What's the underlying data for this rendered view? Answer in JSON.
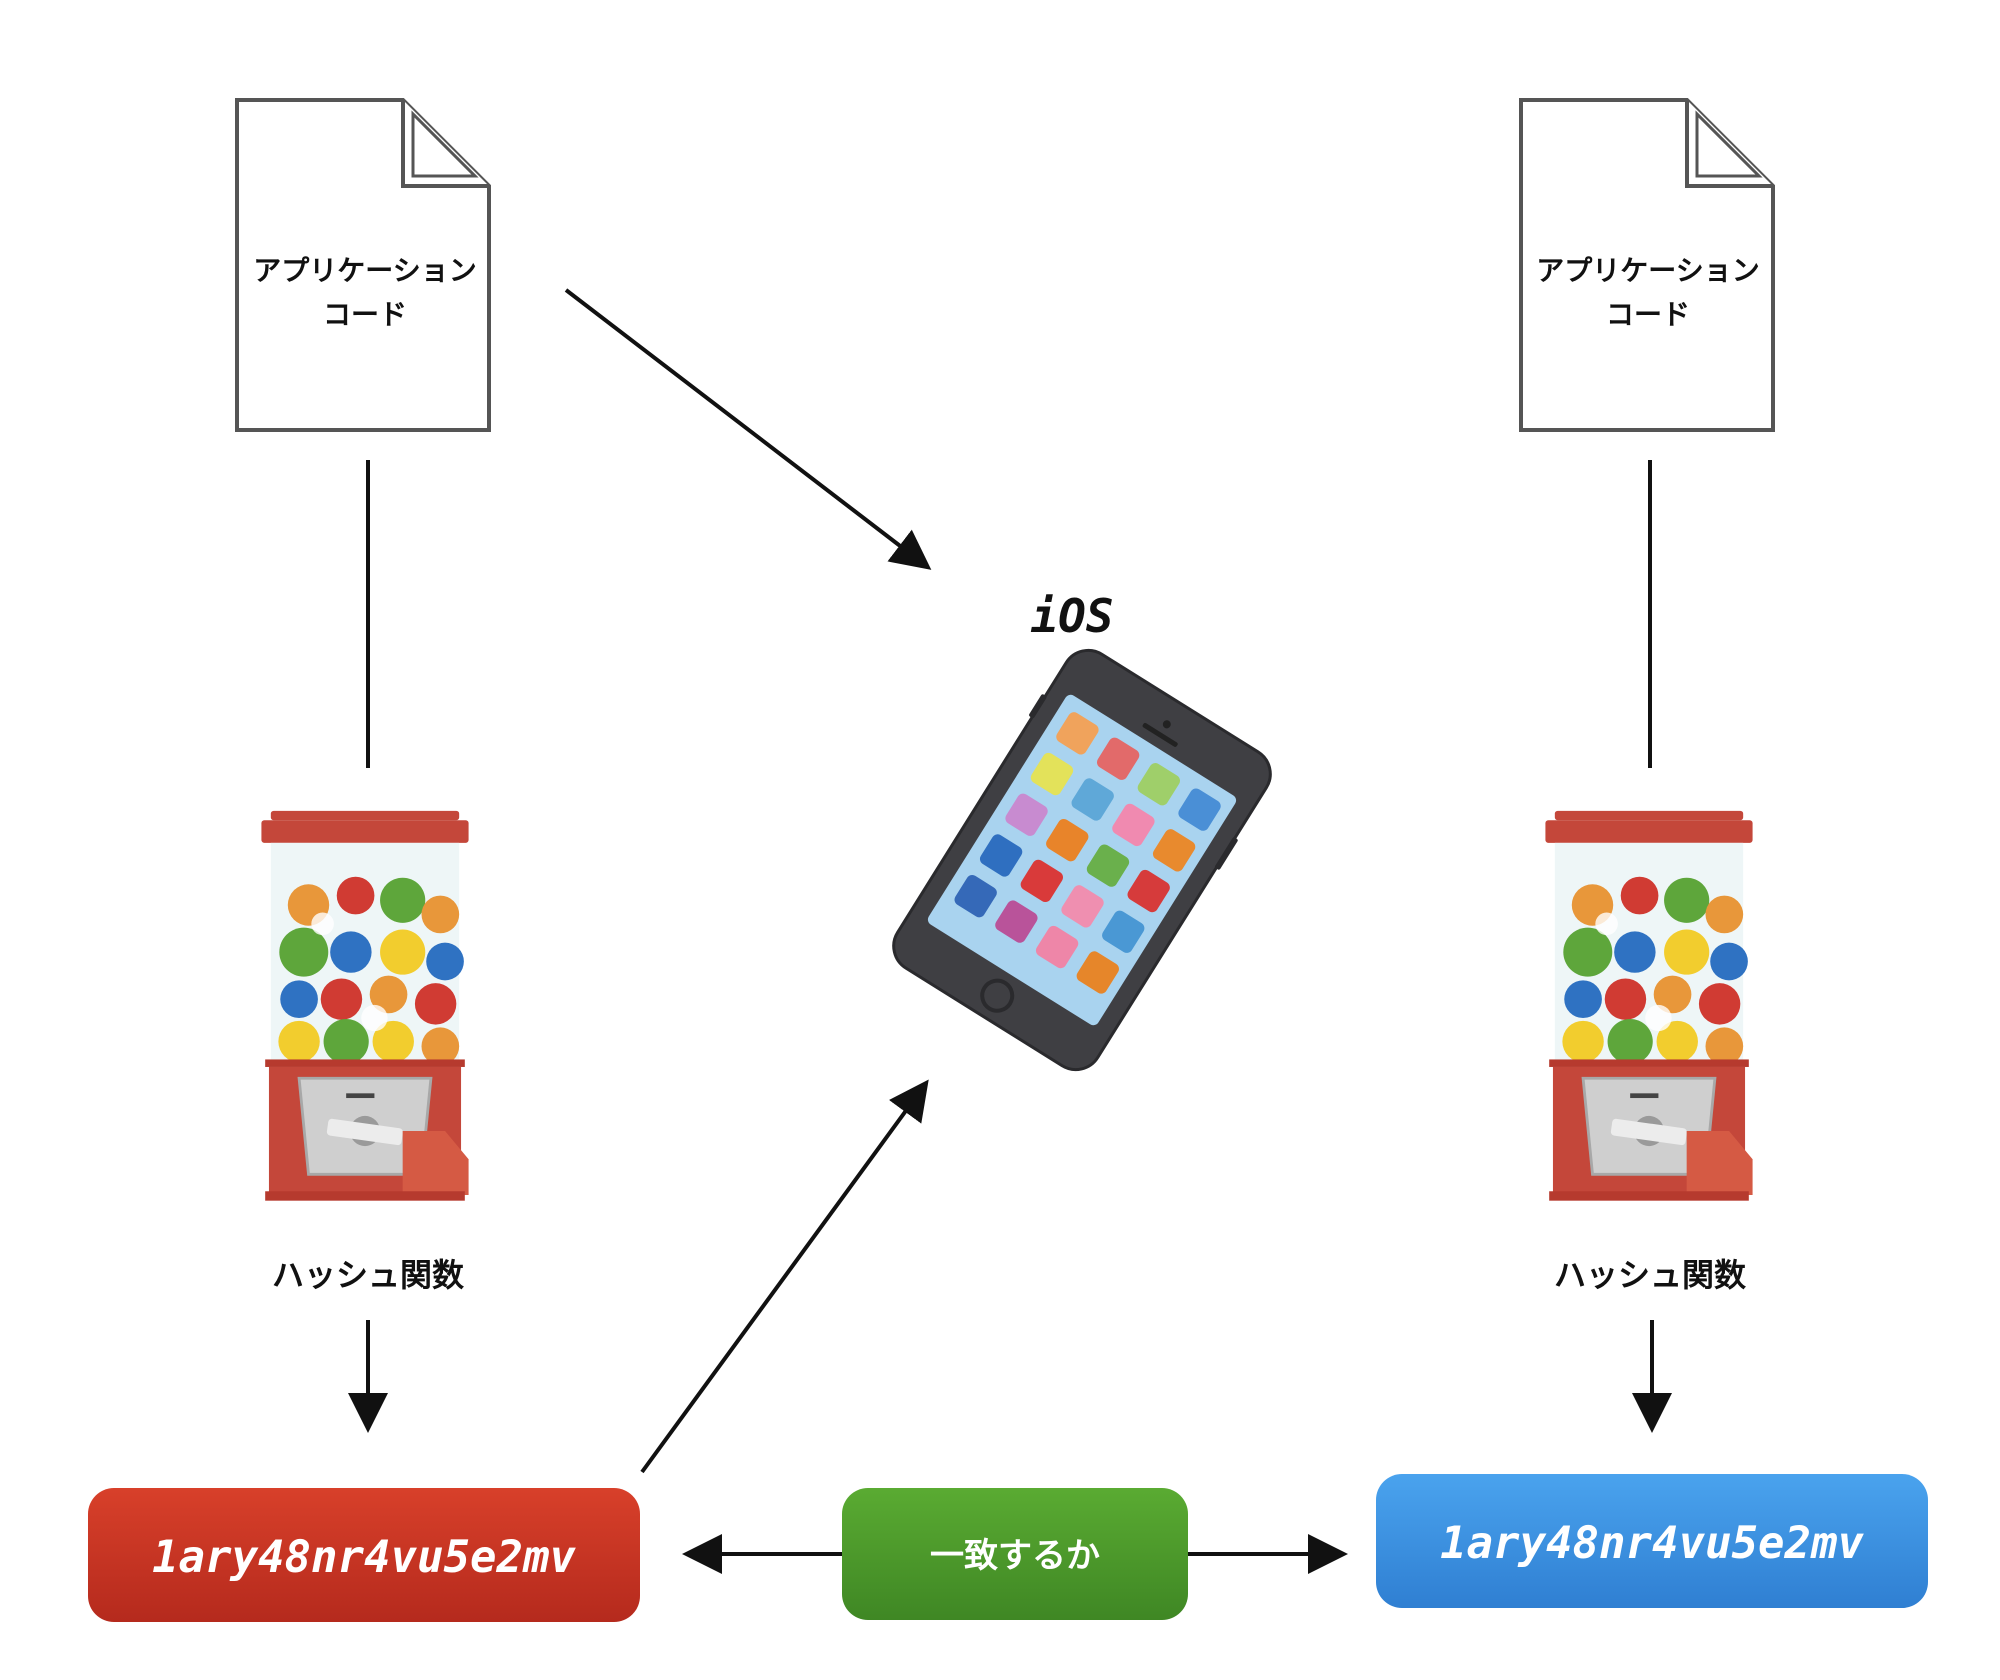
{
  "left_doc": {
    "line1": "アプリケーション",
    "line2": "コード"
  },
  "right_doc": {
    "line1": "アプリケーション",
    "line2": "コード"
  },
  "left_hash_label": "ハッシュ関数",
  "right_hash_label": "ハッシュ関数",
  "ios_label": "iOS",
  "left_hash_value": "1ary48nr4vu5e2mv",
  "right_hash_value": "1ary48nr4vu5e2mv",
  "match_label": "一致するか",
  "colors": {
    "left_box": "#c83422",
    "right_box": "#3b8fe0",
    "match_box": "#4e9a2c",
    "machine_red": "#c4473a"
  },
  "icons": [
    "document-icon",
    "gumball-machine-icon",
    "smartphone-icon"
  ]
}
